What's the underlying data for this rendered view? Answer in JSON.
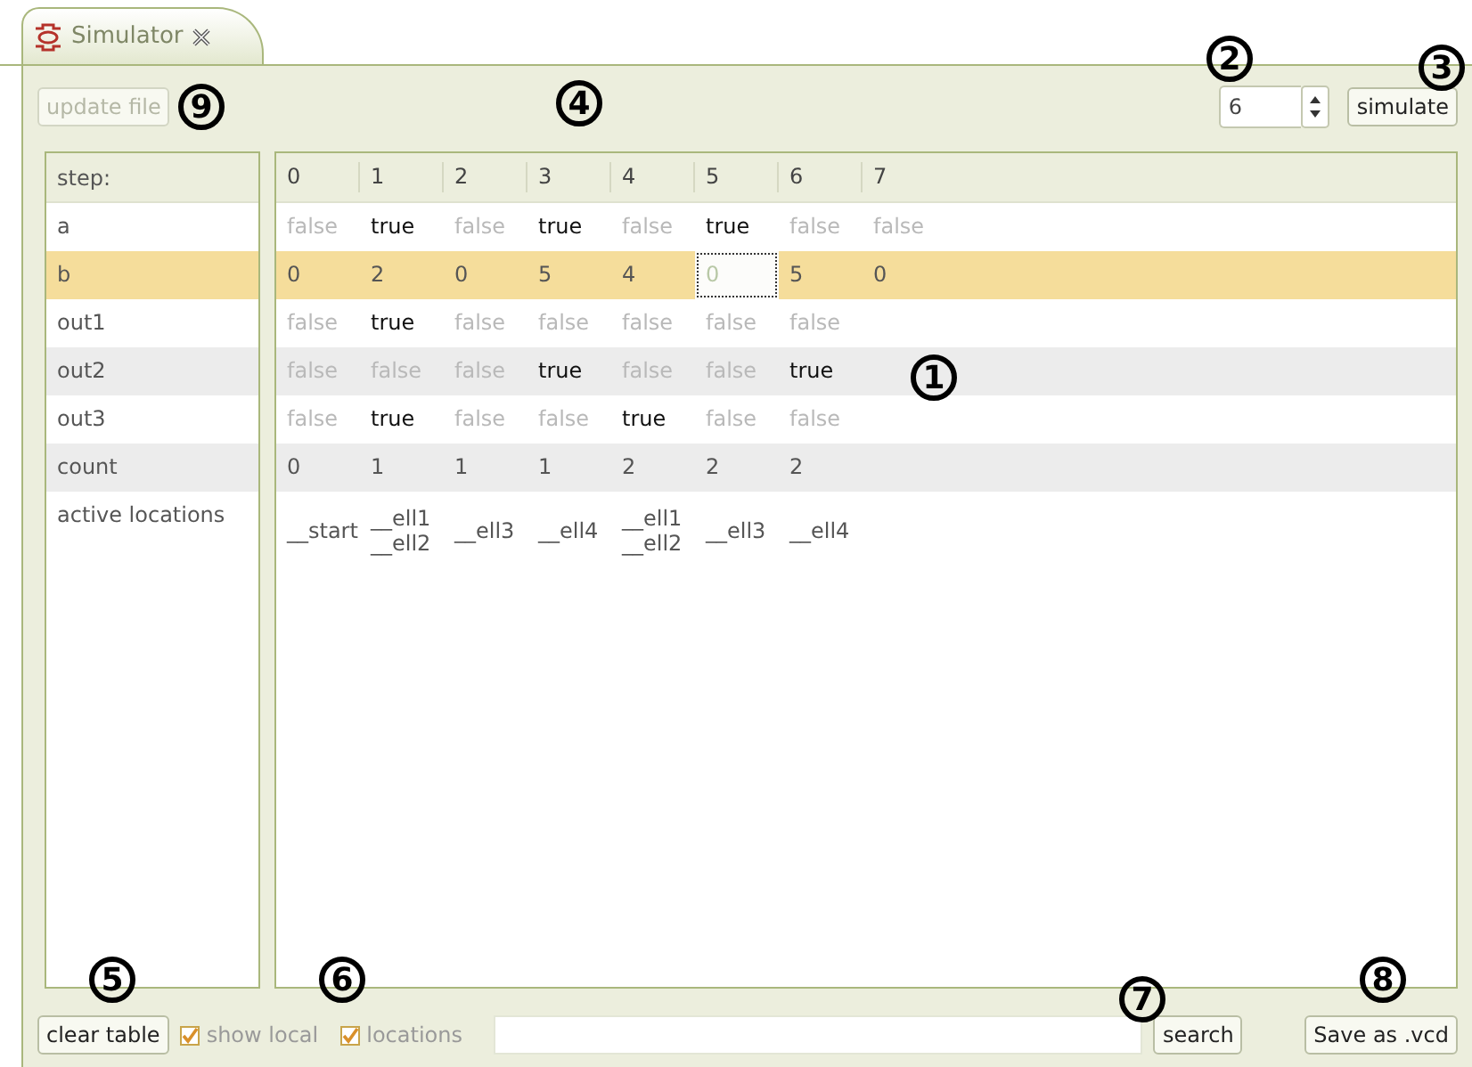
{
  "tab": {
    "title": "Simulator"
  },
  "toolbar": {
    "update_button": {
      "label": "update file",
      "disabled": true
    },
    "steps_field": {
      "value": "6"
    },
    "simulate_button": {
      "label": "simulate"
    }
  },
  "table": {
    "header_label": "step:",
    "columns": [
      "0",
      "1",
      "2",
      "3",
      "4",
      "5",
      "6",
      "7"
    ],
    "rows": [
      {
        "label": "a",
        "selected": false,
        "cells": [
          {
            "text": "false",
            "muted": true
          },
          {
            "text": "true",
            "muted": false
          },
          {
            "text": "false",
            "muted": true
          },
          {
            "text": "true",
            "muted": false
          },
          {
            "text": "false",
            "muted": true
          },
          {
            "text": "true",
            "muted": false
          },
          {
            "text": "false",
            "muted": true
          },
          {
            "text": "false",
            "muted": true
          }
        ]
      },
      {
        "label": "b",
        "selected": true,
        "cells": [
          {
            "text": "0",
            "muted": false,
            "focused": false
          },
          {
            "text": "2",
            "muted": false,
            "focused": false
          },
          {
            "text": "0",
            "muted": false,
            "focused": false
          },
          {
            "text": "5",
            "muted": false,
            "focused": false
          },
          {
            "text": "4",
            "muted": false,
            "focused": false
          },
          {
            "text": "0",
            "muted": false,
            "focused": true
          },
          {
            "text": "5",
            "muted": false,
            "focused": false
          },
          {
            "text": "0",
            "muted": false,
            "focused": false
          }
        ]
      },
      {
        "label": "out1",
        "selected": false,
        "cells": [
          {
            "text": "false",
            "muted": true
          },
          {
            "text": "true",
            "muted": false
          },
          {
            "text": "false",
            "muted": true
          },
          {
            "text": "false",
            "muted": true
          },
          {
            "text": "false",
            "muted": true
          },
          {
            "text": "false",
            "muted": true
          },
          {
            "text": "false",
            "muted": true
          }
        ]
      },
      {
        "label": "out2",
        "selected": false,
        "cells": [
          {
            "text": "false",
            "muted": true
          },
          {
            "text": "false",
            "muted": true
          },
          {
            "text": "false",
            "muted": true
          },
          {
            "text": "true",
            "muted": false
          },
          {
            "text": "false",
            "muted": true
          },
          {
            "text": "false",
            "muted": true
          },
          {
            "text": "true",
            "muted": false
          }
        ]
      },
      {
        "label": "out3",
        "selected": false,
        "cells": [
          {
            "text": "false",
            "muted": true
          },
          {
            "text": "true",
            "muted": false
          },
          {
            "text": "false",
            "muted": true
          },
          {
            "text": "false",
            "muted": true
          },
          {
            "text": "true",
            "muted": false
          },
          {
            "text": "false",
            "muted": true
          },
          {
            "text": "false",
            "muted": true
          }
        ]
      },
      {
        "label": "count",
        "selected": false,
        "cells": [
          {
            "text": "0",
            "muted": false
          },
          {
            "text": "1",
            "muted": false
          },
          {
            "text": "1",
            "muted": false
          },
          {
            "text": "1",
            "muted": false
          },
          {
            "text": "2",
            "muted": false
          },
          {
            "text": "2",
            "muted": false
          },
          {
            "text": "2",
            "muted": false
          }
        ]
      }
    ],
    "locations_row": {
      "label": "active locations",
      "cells": [
        [
          "__start"
        ],
        [
          "__ell1",
          "__ell2"
        ],
        [
          "__ell3"
        ],
        [
          "__ell4"
        ],
        [
          "__ell1",
          "__ell2"
        ],
        [
          "__ell3"
        ],
        [
          "__ell4"
        ]
      ]
    }
  },
  "bottom": {
    "clear_button": "clear table",
    "checkboxes": [
      {
        "label": "show local",
        "checked": true
      },
      {
        "label": "locations",
        "checked": true
      }
    ],
    "search_button": "search",
    "save_button": "Save as .vcd"
  },
  "callouts": [
    "1",
    "2",
    "3",
    "4",
    "5",
    "6",
    "7",
    "8",
    "9"
  ]
}
